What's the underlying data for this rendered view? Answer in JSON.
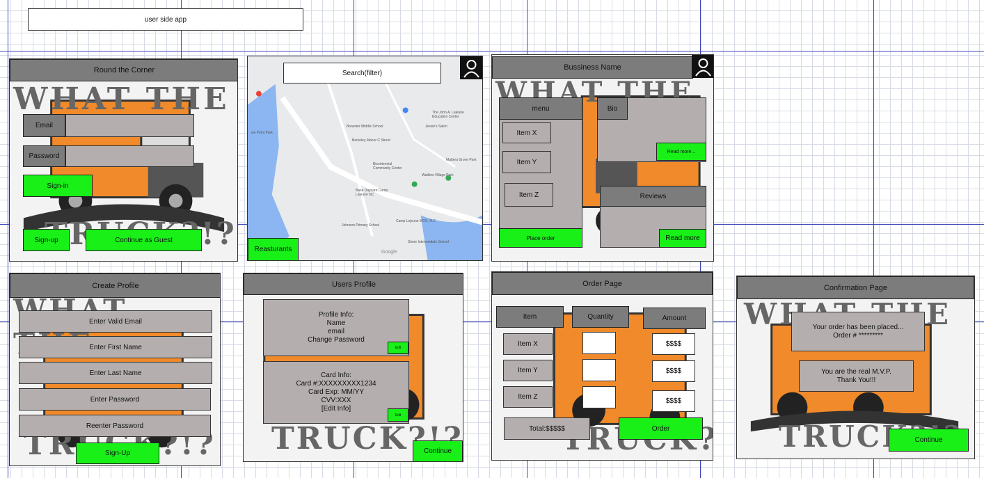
{
  "title": "user side app",
  "login": {
    "header": "Round the Corner",
    "email_label": "Email",
    "password_label": "Password",
    "signin": "Sign-in",
    "signup": "Sign-up",
    "guest": "Continue as Guest"
  },
  "map": {
    "search": "Search(filter)",
    "restaurants": "Reasturants",
    "labels": [
      "The John A. Lejeune Education Center",
      "Brewster Middle School",
      "Jessie's Salon",
      "Berkeley Manor C Street",
      "Bicentennial Community Center",
      "Mattera Grove Park",
      "Watkins Village Park",
      "Base Daycare Camp Lejeune NC",
      "Camp Lejeune MCO, N.C",
      "Johnson Primary School",
      "Stone Intermediate School",
      "Google",
      "ew Point Park"
    ]
  },
  "business": {
    "header": "Bussiness Name",
    "menu": "menu",
    "items": [
      "Item X",
      "Item Y",
      "Item Z"
    ],
    "place_order": "Place order",
    "bio": "Bio",
    "read_more_bio": "Read more...",
    "reviews": "Reviews",
    "read_more": "Read more"
  },
  "create_profile": {
    "header": "Create Profile",
    "fields": [
      "Enter Valid Email",
      "Enter First Name",
      "Enter Last Name",
      "Enter Password",
      "Reenter Password"
    ],
    "signup": "Sign-Up"
  },
  "users_profile": {
    "header": "Users Profile",
    "profile_info": "Profile Info:\nName\nemail\nChange Password",
    "card_info": "Card Info:\nCard  #:XXXXXXXXX1234\nCard Exp: MM/YY\nCVV:XXX\n[Edit Info]",
    "edit": "Edit",
    "continue": "Continue"
  },
  "order_page": {
    "header": "Order Page",
    "col_item": "Item",
    "col_quantity": "Quantity",
    "col_amount": "Amount",
    "items": [
      "Item X",
      "Item Y",
      "Item Z"
    ],
    "amounts": [
      "$$$$",
      "$$$$",
      "$$$$"
    ],
    "total": "Total:$$$$$",
    "order": "Order"
  },
  "confirmation": {
    "header": "Confirmation Page",
    "message": "Your order has been placed...\nOrder # *********",
    "thanks": "You are the real M.V.P.\nThank You!!!",
    "continue": "Continue"
  },
  "background_art": {
    "line1": "WHAT THE",
    "line2": "TRUCK?!?"
  },
  "colors": {
    "button_green": "#18f018",
    "header_gray": "#7c7c7c",
    "box_gray": "#b4aeae",
    "truck_orange": "#f08a2a"
  }
}
